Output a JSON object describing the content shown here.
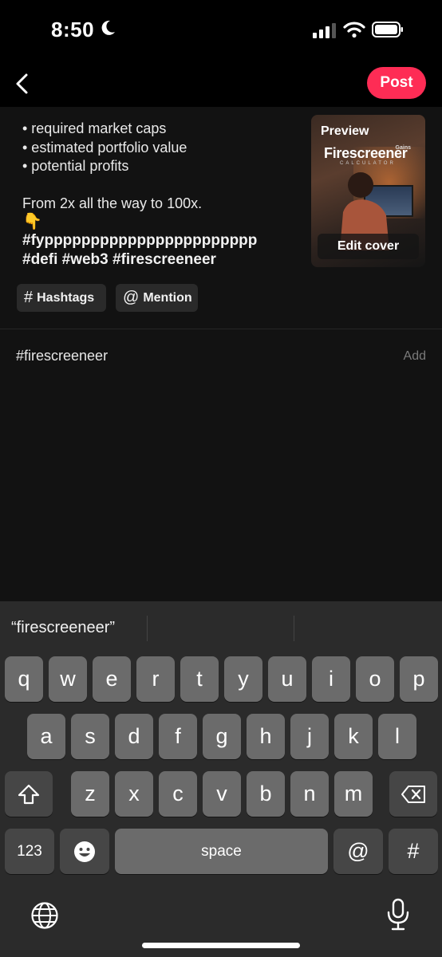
{
  "status": {
    "time": "8:50"
  },
  "header": {
    "post_label": "Post"
  },
  "caption": {
    "lines": [
      "• required market caps",
      "• estimated portfolio value",
      "• potential profits"
    ],
    "line4": "From 2x all the way to 100x.",
    "emoji": "👇",
    "tags_line1": "#fyppppppppppppppppppppppp",
    "tags_line2": "#defi #web3 #firescreeneer"
  },
  "preview": {
    "label": "Preview",
    "logo": "Firescreener",
    "logo_small": "Gains",
    "logo_sub": "CALCULATOR",
    "edit_cover": "Edit cover"
  },
  "chips": {
    "hashtags": {
      "symbol": "#",
      "label": "Hashtags"
    },
    "mention": {
      "symbol": "@",
      "label": "Mention"
    }
  },
  "suggestion": {
    "tag": "#firescreeneer",
    "add": "Add"
  },
  "keyboard": {
    "predictive": "“firescreeneer”",
    "row1": [
      "q",
      "w",
      "e",
      "r",
      "t",
      "y",
      "u",
      "i",
      "o",
      "p"
    ],
    "row2": [
      "a",
      "s",
      "d",
      "f",
      "g",
      "h",
      "j",
      "k",
      "l"
    ],
    "row3": [
      "z",
      "x",
      "c",
      "v",
      "b",
      "n",
      "m"
    ],
    "numbers_label": "123",
    "space_label": "space",
    "at_label": "@",
    "hash_label": "#"
  }
}
